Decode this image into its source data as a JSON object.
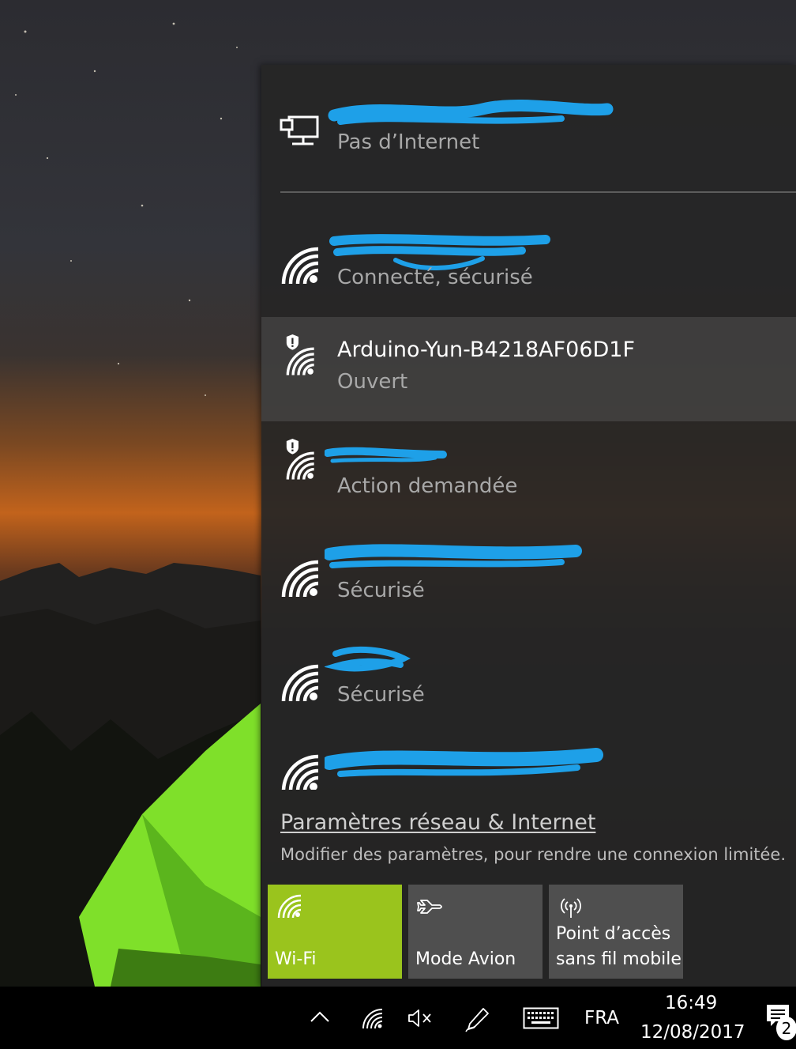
{
  "networks": [
    {
      "name": "",
      "status": "Pas d’Internet",
      "type": "ethernet",
      "redacted": true
    },
    {
      "name": "",
      "status": "Connecté, sécurisé",
      "type": "wifi",
      "redacted": true
    },
    {
      "name": "Arduino-Yun-B4218AF06D1F",
      "status": "Ouvert",
      "type": "wifi-open",
      "redacted": false
    },
    {
      "name": "",
      "status": "Action demandée",
      "type": "wifi-open",
      "redacted": true
    },
    {
      "name": "",
      "status": "Sécurisé",
      "type": "wifi",
      "redacted": true
    },
    {
      "name": "",
      "status": "Sécurisé",
      "type": "wifi",
      "redacted": true
    },
    {
      "name": "",
      "status": "",
      "type": "wifi",
      "redacted": true
    }
  ],
  "settings": {
    "link_label": "Paramètres réseau & Internet",
    "description": "Modifier des paramètres, pour rendre une connexion limitée."
  },
  "quick_actions": [
    {
      "label": "Wi-Fi",
      "icon": "wifi-icon",
      "active": true
    },
    {
      "label": "Mode Avion",
      "icon": "airplane-icon",
      "active": false
    },
    {
      "label": "Point d’accès\nsans fil mobile",
      "icon": "hotspot-icon",
      "active": false
    }
  ],
  "taskbar": {
    "language": "FRA",
    "time": "16:49",
    "date": "12/08/2017",
    "notification_count": "2"
  },
  "colors": {
    "accent": "#9ac41d",
    "redaction": "#1ea0e8",
    "flyout_bg": "#262626"
  }
}
